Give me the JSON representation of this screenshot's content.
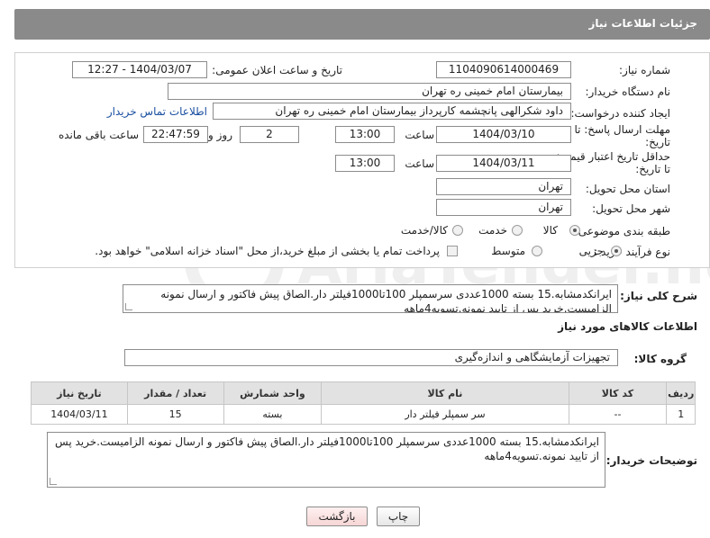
{
  "header": {
    "title": "جزئیات اطلاعات نیاز"
  },
  "form": {
    "need_number_label": "شماره نیاز:",
    "need_number": "1104090614000469",
    "announce_label": "تاریخ و ساعت اعلان عمومی:",
    "announce_value": "1404/03/07 - 12:27",
    "buyer_org_label": "نام دستگاه خریدار:",
    "buyer_org": "بیمارستان امام خمینی ره  تهران",
    "creator_label": "ایجاد کننده درخواست:",
    "creator": "داود شکرالهی پانچشمه کارپرداز بیمارستان امام خمینی ره  تهران",
    "contact_link": "اطلاعات تماس خریدار",
    "deadline_label_1": "مهلت ارسال پاسخ: تا",
    "deadline_label_2": "تاریخ:",
    "deadline_date": "1404/03/10",
    "time_label": "ساعت",
    "deadline_time": "13:00",
    "days_value": "2",
    "days_label": "روز و",
    "remaining_time": "22:47:59",
    "remaining_label": "ساعت باقی مانده",
    "price_validity_label_1": "حداقل تاریخ اعتبار قیمت:",
    "price_validity_label_2": "تا تاریخ:",
    "price_validity_date": "1404/03/11",
    "price_validity_time": "13:00",
    "province_label": "استان محل تحویل:",
    "province": "تهران",
    "city_label": "شهر محل تحویل:",
    "city": "تهران",
    "category_label": "طبقه بندی موضوعی:",
    "category_options": [
      "کالا",
      "خدمت",
      "کالا/خدمت"
    ],
    "process_label": "نوع فرآیند خرید :",
    "process_options": [
      "جزیی",
      "متوسط"
    ],
    "payment_note": "پرداخت تمام یا بخشی از مبلغ خرید،از محل \"اسناد خزانه اسلامی\" خواهد بود."
  },
  "description": {
    "label": "شرح کلی نیاز:",
    "text": "ایرانکدمشابه.15 بسته 1000عددی سرسمپلر 100تا1000فیلتر دار.الصاق پیش فاکتور و ارسال نمونه الزامیست.خرید پس از تایید نمونه.تسویه4ماهه"
  },
  "goods_section": {
    "title": "اطلاعات کالاهای مورد نیاز",
    "group_label": "گروه کالا:",
    "group_value": "تجهیزات آزمایشگاهی و اندازه‌گیری"
  },
  "table": {
    "headers": [
      "ردیف",
      "کد کالا",
      "نام کالا",
      "واحد شمارش",
      "تعداد / مقدار",
      "تاریخ نیاز"
    ],
    "rows": [
      [
        "1",
        "--",
        "سر سمپلر فیلتر دار",
        "بسته",
        "15",
        "1404/03/11"
      ]
    ]
  },
  "buyer_notes": {
    "label": "توضیحات خریدار:",
    "text": "ایرانکدمشابه.15 بسته 1000عددی سرسمپلر 100تا1000فیلتر دار.الصاق پیش فاکتور و ارسال نمونه الزامیست.خرید پس از تایید نمونه.تسویه4ماهه"
  },
  "buttons": {
    "print": "چاپ",
    "back": "بازگشت"
  },
  "watermark_text": "AriaTender.neT",
  "colors": {
    "header_bg": "#8a8a8a",
    "link": "#1a4fa0",
    "back_button": "#f6d6d6"
  }
}
